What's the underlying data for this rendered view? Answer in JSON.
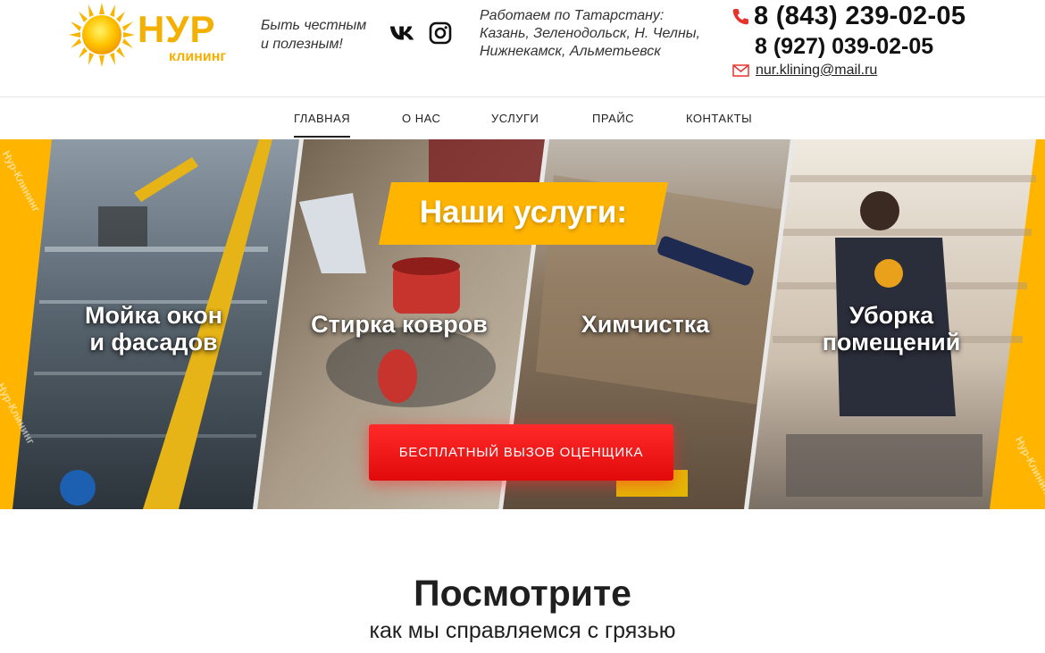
{
  "header": {
    "logo": {
      "name": "НУР",
      "sub": "клининг"
    },
    "slogan": [
      "Быть честным",
      "и полезным!"
    ],
    "socials": [
      {
        "icon": "vk-icon"
      },
      {
        "icon": "instagram-icon"
      }
    ],
    "region": [
      "Работаем по Татарстану:",
      "Казань, Зеленодольск, Н. Челны,",
      "Нижнекамск, Альметьевск"
    ],
    "phone_primary": "8 (843) 239-02-05",
    "phone_secondary": "8 (927) 039-02-05",
    "email": "nur.klining@mail.ru",
    "icons": {
      "phone": "phone-icon",
      "mail": "mail-icon"
    }
  },
  "nav": {
    "items": [
      {
        "label": "ГЛАВНАЯ",
        "active": true
      },
      {
        "label": "О НАС",
        "active": false
      },
      {
        "label": "УСЛУГИ",
        "active": false
      },
      {
        "label": "ПРАЙС",
        "active": false
      },
      {
        "label": "КОНТАКТЫ",
        "active": false
      }
    ]
  },
  "hero": {
    "banner": "Наши услуги:",
    "panels": [
      {
        "label": [
          "Мойка окон",
          "и фасадов"
        ]
      },
      {
        "label": [
          "Стирка ковров"
        ]
      },
      {
        "label": [
          "Химчистка"
        ]
      },
      {
        "label": [
          "Уборка",
          "помещений"
        ]
      }
    ],
    "cta": "БЕСПЛАТНЫЙ ВЫЗОВ ОЦЕНЩИКА",
    "watermark": "Нур-Клининг",
    "colors": {
      "accent": "#ffb400",
      "cta": "#f01414"
    }
  },
  "section": {
    "title": "Посмотрите",
    "subtitle": "как мы справляемся с грязью"
  }
}
